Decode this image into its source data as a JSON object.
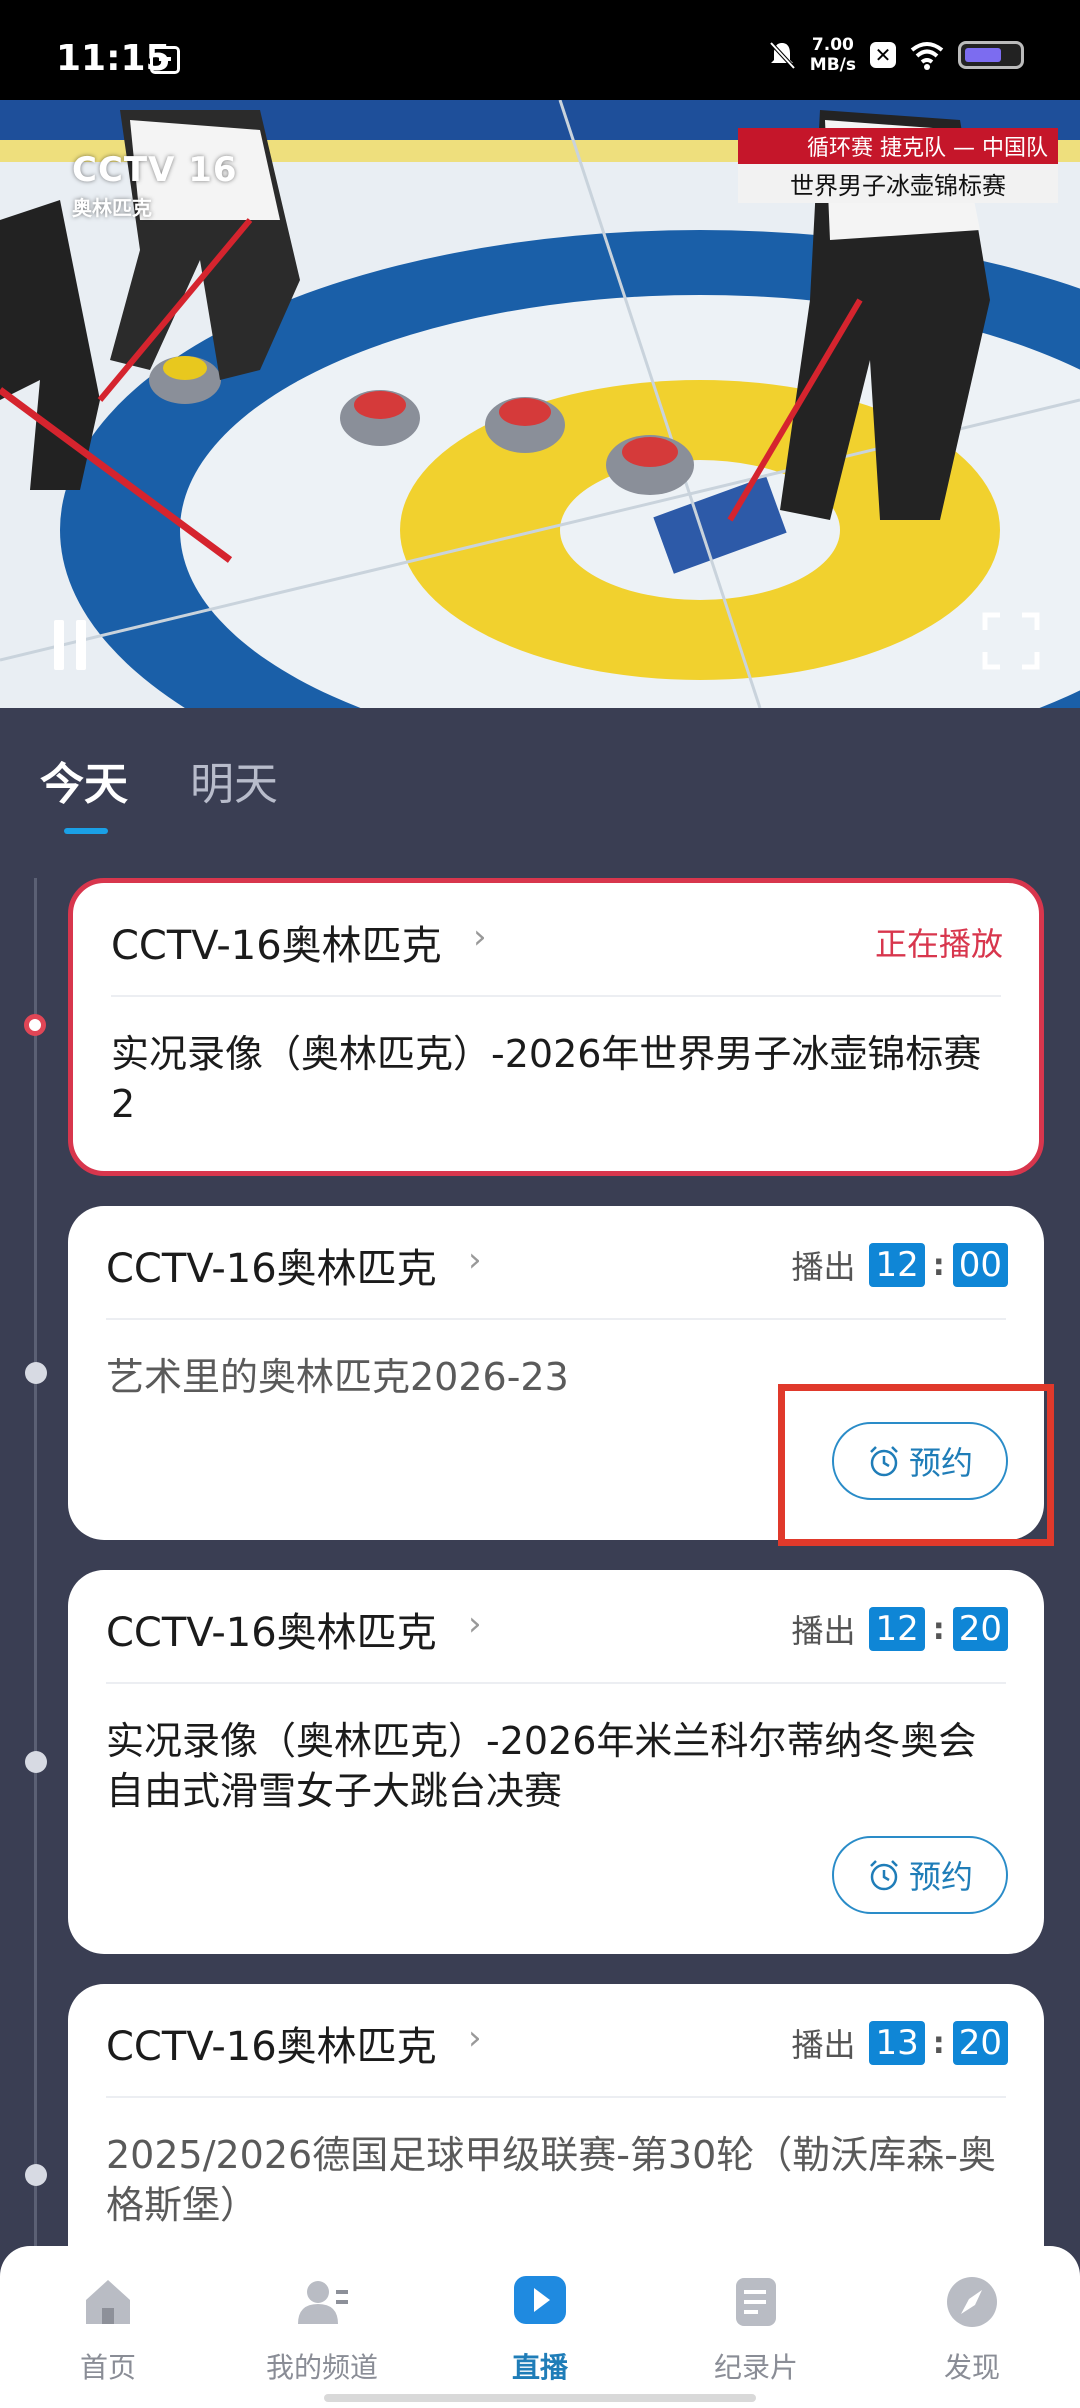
{
  "status_bar": {
    "time": "11:15",
    "net_speed_value": "7.00",
    "net_speed_unit": "MB/s",
    "battery_level": 0.7
  },
  "video": {
    "channel_logo_line1": "CCTV 16",
    "channel_logo_line2": "奥林匹克",
    "caption_top": "循环赛  捷克队 — 中国队",
    "caption_bottom": "世界男子冰壶锦标赛",
    "colors": {
      "ice": "#e8eef2",
      "ring_blue": "#1a5fa8",
      "ring_yellow": "#f1d12e"
    }
  },
  "tabs": [
    {
      "label": "今天",
      "active": true
    },
    {
      "label": "明天",
      "active": false
    }
  ],
  "cards": [
    {
      "channel": "CCTV-16奥林匹克",
      "status": "正在播放",
      "title": "实况录像（奥林匹克）-2026年世界男子冰壶锦标赛2",
      "live": true
    },
    {
      "channel": "CCTV-16奥林匹克",
      "airs_label": "播出",
      "hour": "12",
      "minute": "00",
      "title": "艺术里的奥林匹克2026-23",
      "reserve_label": "预约"
    },
    {
      "channel": "CCTV-16奥林匹克",
      "airs_label": "播出",
      "hour": "12",
      "minute": "20",
      "title": "实况录像（奥林匹克）-2026年米兰科尔蒂纳冬奥会 自由式滑雪女子大跳台决赛",
      "reserve_label": "预约"
    },
    {
      "channel": "CCTV-16奥林匹克",
      "airs_label": "播出",
      "hour": "13",
      "minute": "20",
      "title": "2025/2026德国足球甲级联赛-第30轮（勒沃库森-奥格斯堡）"
    }
  ],
  "bottom_nav": [
    {
      "label": "首页",
      "icon": "home-icon"
    },
    {
      "label": "我的频道",
      "icon": "my-channel-icon"
    },
    {
      "label": "直播",
      "icon": "live-play-icon",
      "active": true
    },
    {
      "label": "纪录片",
      "icon": "documentary-icon"
    },
    {
      "label": "发现",
      "icon": "compass-icon"
    }
  ],
  "colors": {
    "background": "#3a3e53",
    "accent": "#0f86d6",
    "live_red": "#d8364d",
    "highlight_red": "#e0392b"
  }
}
